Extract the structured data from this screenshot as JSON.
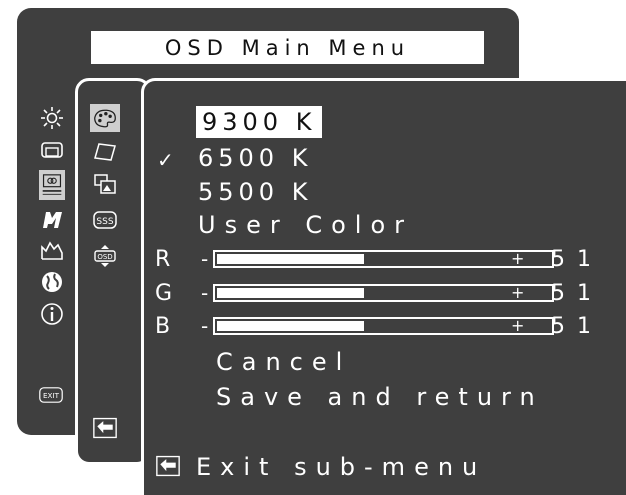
{
  "menu": {
    "title": "OSD Main Menu",
    "main_icons": [
      "brightness-icon",
      "position-icon",
      "color-icon",
      "tools-icon",
      "signal-icon",
      "language-icon",
      "info-icon",
      "exit-icon"
    ],
    "main_icon_labels": {
      "exit": "EXIT"
    },
    "sub_icons": [
      "color-palette-icon",
      "parallelogram-icon",
      "overlap-windows-icon",
      "sss-icon",
      "osd-position-icon",
      "back-arrow-icon"
    ],
    "sub_icon_labels": {
      "sss": "SSS",
      "osd": "OSD"
    }
  },
  "options": {
    "k9300": "9300 K",
    "k6500": "6500 K",
    "k5500": "5500 K",
    "user_color": "User Color",
    "check_mark": "✓"
  },
  "sliders": [
    {
      "label": "R",
      "minus": "-",
      "plus": "+",
      "value": "51",
      "level": 0.44
    },
    {
      "label": "G",
      "minus": "-",
      "plus": "+",
      "value": "51",
      "level": 0.44
    },
    {
      "label": "B",
      "minus": "-",
      "plus": "+",
      "value": "51",
      "level": 0.44
    }
  ],
  "actions": {
    "cancel": "Cancel",
    "save": "Save and return",
    "exit_sub_menu": "Exit sub-menu"
  },
  "colors": {
    "panel": "#3f3f3f",
    "text": "#ffffff",
    "highlight": "#ffffff"
  }
}
